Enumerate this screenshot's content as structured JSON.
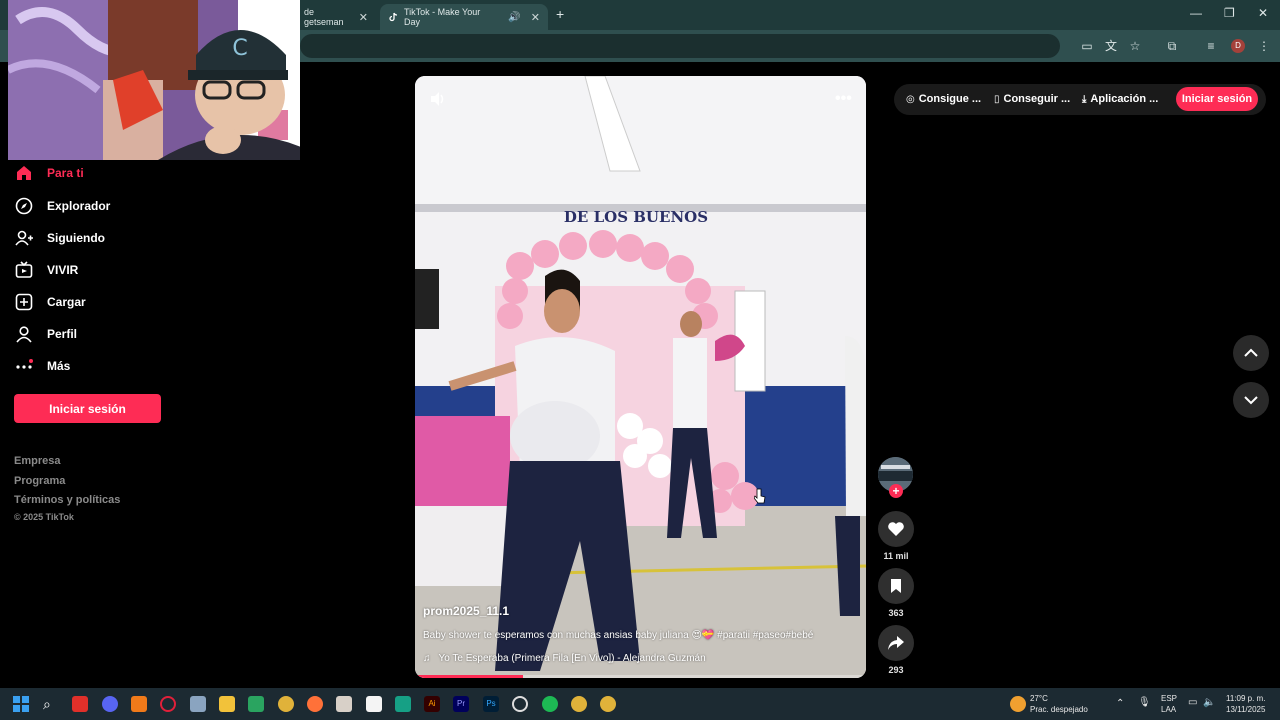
{
  "browser": {
    "tabs": [
      {
        "title": "de getseman",
        "active": false
      },
      {
        "title": "TikTok - Make Your Day",
        "active": true
      }
    ],
    "profile_initial": "D"
  },
  "sidebar": {
    "items": [
      {
        "label": "Para ti",
        "icon": "home-icon",
        "active": true
      },
      {
        "label": "Explorador",
        "icon": "compass-icon",
        "active": false
      },
      {
        "label": "Siguiendo",
        "icon": "following-icon",
        "active": false
      },
      {
        "label": "VIVIR",
        "icon": "live-icon",
        "active": false
      },
      {
        "label": "Cargar",
        "icon": "upload-icon",
        "active": false
      },
      {
        "label": "Perfil",
        "icon": "profile-icon",
        "active": false
      },
      {
        "label": "Más",
        "icon": "more-icon",
        "active": false
      }
    ],
    "login_label": "Iniciar sesión",
    "footer_links": [
      "Empresa",
      "Programa",
      "Términos y políticas"
    ],
    "copyright": "© 2025 TikTok"
  },
  "video": {
    "banner_text": "DE LOS BUENOS",
    "username": "prom2025_11.1",
    "caption": "Baby shower te esperamos con muchas ansias baby juliana 😍💝 #paratii #paseo#bebé",
    "music": "Yo Te Esperaba (Primera Fila [En Vivo]) - Alejandra Guzmán",
    "progress": 0.24
  },
  "actions": {
    "likes": "11 mil",
    "saves": "363",
    "shares": "293"
  },
  "topbar": {
    "item1": "Consigue ...",
    "item2": "Conseguir ...",
    "item3": "Aplicación ...",
    "signin": "Iniciar sesión"
  },
  "tray": {
    "temperature": "27°C",
    "weather": "Prac. despejado",
    "lang1": "ESP",
    "lang2": "LAA",
    "time": "11:09 p. m.",
    "date": "13/11/2025"
  },
  "colors": {
    "accent": "#fe2c55",
    "browser_frame": "#2f4f4f",
    "background": "#000000"
  }
}
